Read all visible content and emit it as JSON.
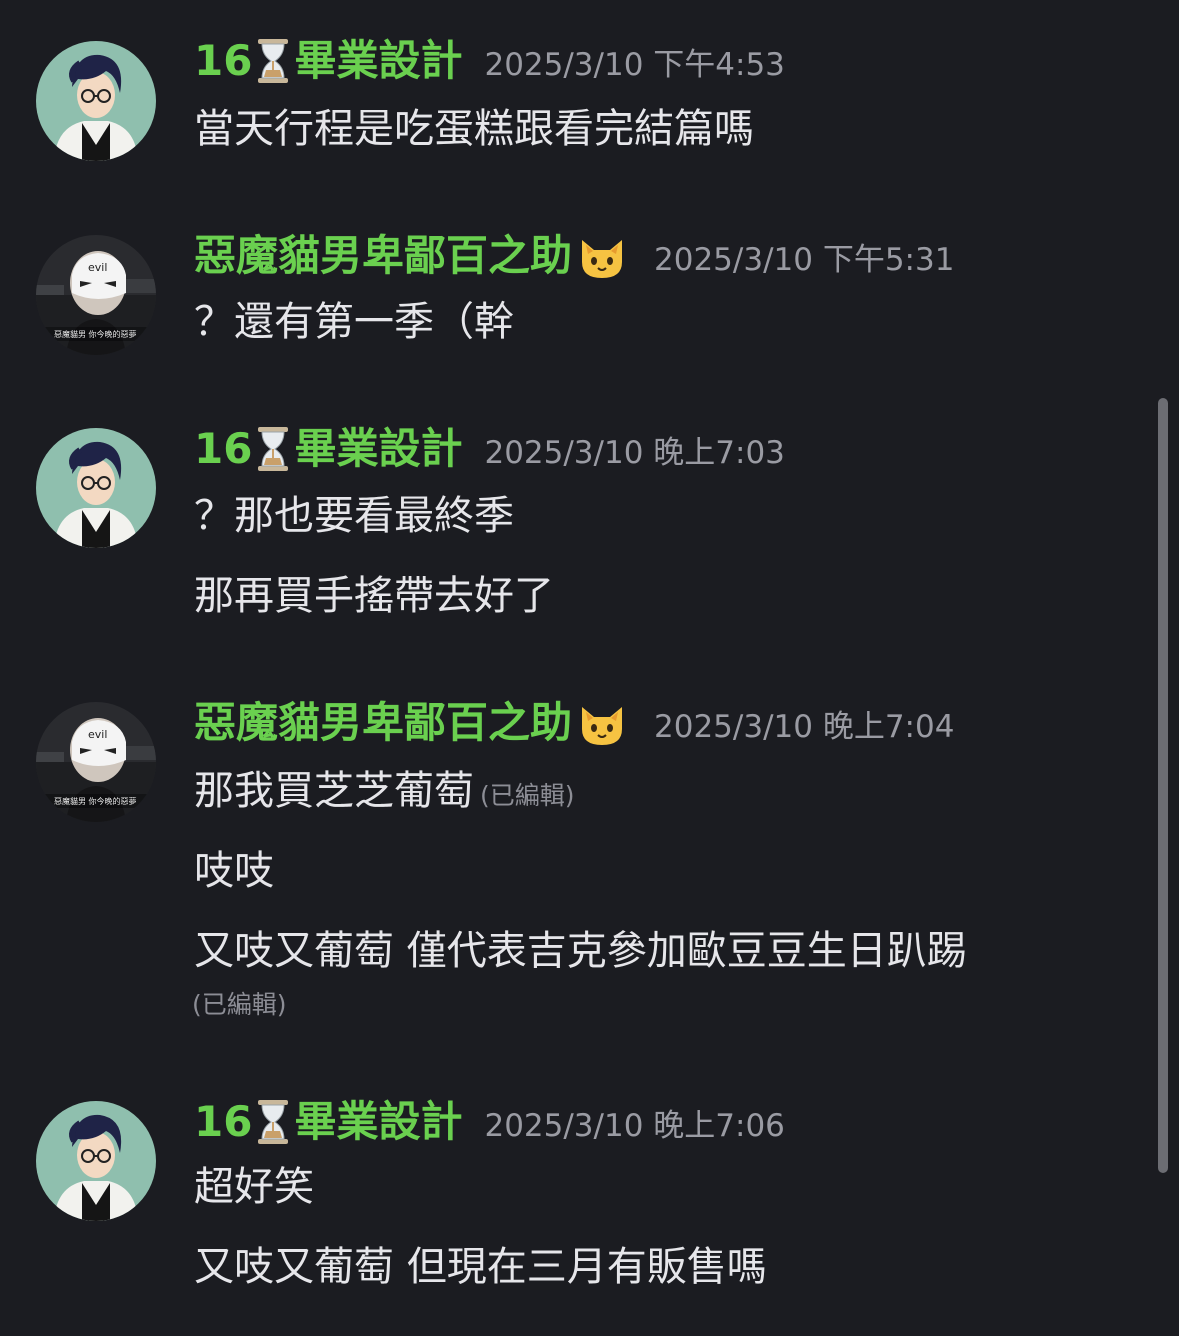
{
  "users": {
    "user1": {
      "name_prefix": "16",
      "name_suffix": "畢業設計",
      "emoji": "hourglass-icon"
    },
    "user2": {
      "name": "惡魔貓男卑鄙百之助",
      "emoji": "cat-face-icon",
      "avatar_caption": "惡魔貓男 你今晚的惡夢",
      "mask_text": "evil"
    }
  },
  "messages": [
    {
      "timestamp": "2025/3/10 下午4:53",
      "lines": [
        "當天行程是吃蛋糕跟看完結篇嗎"
      ]
    },
    {
      "timestamp": "2025/3/10 下午5:31",
      "lines": [
        "？還有第一季（幹"
      ]
    },
    {
      "timestamp": "2025/3/10 晚上7:03",
      "lines": [
        "？那也要看最終季",
        "那再買手搖帶去好了"
      ]
    },
    {
      "timestamp": "2025/3/10 晚上7:04",
      "lines": [
        "那我買芝芝葡萄",
        "吱吱",
        "又吱又葡萄 僅代表吉克參加歐豆豆生日趴踢"
      ],
      "edited_label": "(已編輯)"
    },
    {
      "timestamp": "2025/3/10 晚上7:06",
      "lines": [
        "超好笑",
        "又吱又葡萄 但現在三月有販售嗎"
      ]
    }
  ]
}
